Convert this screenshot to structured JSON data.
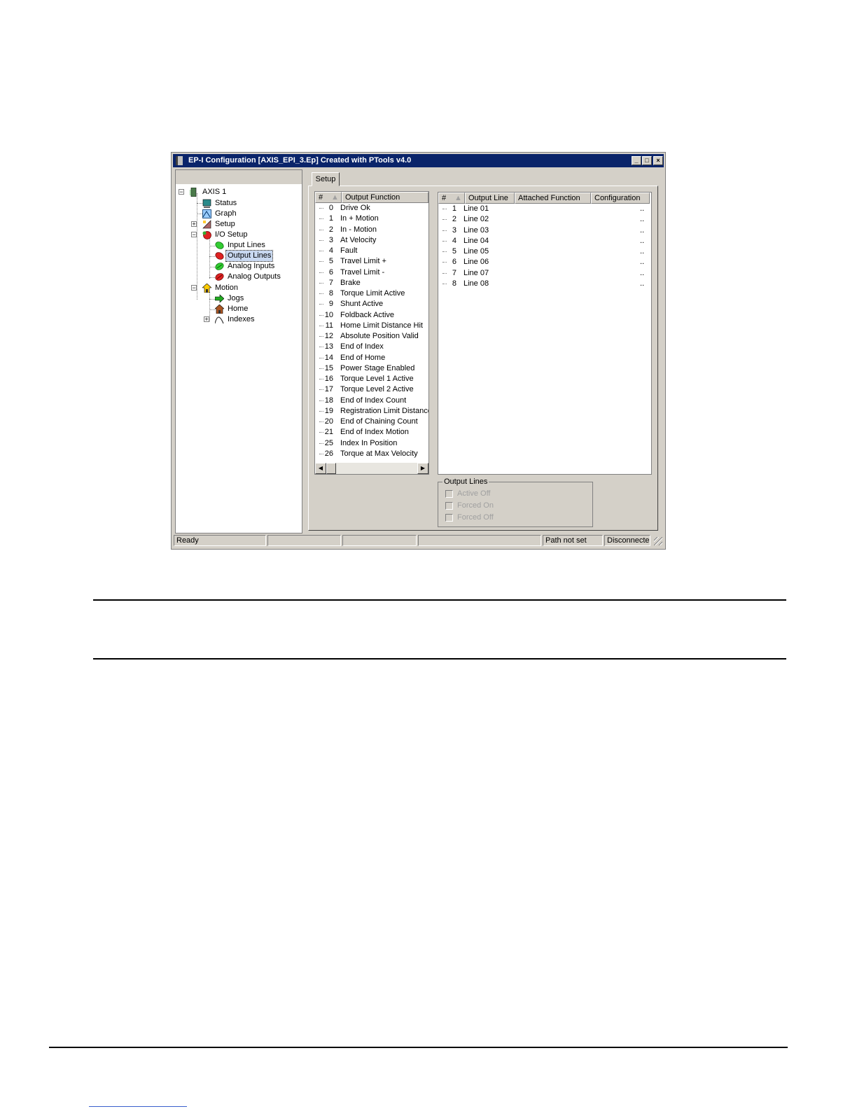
{
  "window": {
    "title": "EP-I Configuration  [AXIS_EPI_3.Ep] Created with PTools v4.0",
    "buttons": {
      "minimize": "_",
      "maximize": "□",
      "close": "×"
    }
  },
  "tree": {
    "root": "AXIS 1",
    "items": {
      "status": "Status",
      "graph": "Graph",
      "setup": "Setup",
      "io_setup": "I/O Setup",
      "input_lines": "Input Lines",
      "output_lines": "Output Lines",
      "analog_inputs": "Analog Inputs",
      "analog_outputs": "Analog Outputs",
      "motion": "Motion",
      "jogs": "Jogs",
      "home": "Home",
      "indexes": "Indexes"
    },
    "selected": "Output Lines"
  },
  "tab": {
    "label": "Setup"
  },
  "output_functions": {
    "headers": {
      "num": "#",
      "name": "Output Function"
    },
    "rows": [
      {
        "num": "0",
        "name": "Drive Ok"
      },
      {
        "num": "1",
        "name": "In + Motion"
      },
      {
        "num": "2",
        "name": "In - Motion"
      },
      {
        "num": "3",
        "name": "At Velocity"
      },
      {
        "num": "4",
        "name": "Fault"
      },
      {
        "num": "5",
        "name": "Travel Limit +"
      },
      {
        "num": "6",
        "name": "Travel Limit -"
      },
      {
        "num": "7",
        "name": "Brake"
      },
      {
        "num": "8",
        "name": "Torque Limit Active"
      },
      {
        "num": "9",
        "name": "Shunt Active"
      },
      {
        "num": "10",
        "name": "Foldback Active"
      },
      {
        "num": "11",
        "name": "Home Limit Distance Hit"
      },
      {
        "num": "12",
        "name": "Absolute Position Valid"
      },
      {
        "num": "13",
        "name": "End of Index"
      },
      {
        "num": "14",
        "name": "End of Home"
      },
      {
        "num": "15",
        "name": "Power Stage Enabled"
      },
      {
        "num": "16",
        "name": "Torque Level 1 Active"
      },
      {
        "num": "17",
        "name": "Torque Level 2 Active"
      },
      {
        "num": "18",
        "name": "End of Index Count"
      },
      {
        "num": "19",
        "name": "Registration Limit Distance Hit"
      },
      {
        "num": "20",
        "name": "End of Chaining Count"
      },
      {
        "num": "21",
        "name": "End of Index Motion"
      },
      {
        "num": "25",
        "name": "Index In Position"
      },
      {
        "num": "26",
        "name": "Torque at Max Velocity"
      }
    ],
    "scroll": {
      "left": "◀",
      "right": "▶"
    }
  },
  "output_lines": {
    "headers": {
      "num": "#",
      "line": "Output Line",
      "function": "Attached Function",
      "config": "Configuration"
    },
    "rows": [
      {
        "num": "1",
        "line": "Line 01",
        "config": ".."
      },
      {
        "num": "2",
        "line": "Line 02",
        "config": ".."
      },
      {
        "num": "3",
        "line": "Line 03",
        "config": ".."
      },
      {
        "num": "4",
        "line": "Line 04",
        "config": ".."
      },
      {
        "num": "5",
        "line": "Line 05",
        "config": ".."
      },
      {
        "num": "6",
        "line": "Line 06",
        "config": ".."
      },
      {
        "num": "7",
        "line": "Line 07",
        "config": ".."
      },
      {
        "num": "8",
        "line": "Line 08",
        "config": ".."
      }
    ]
  },
  "output_group": {
    "title": "Output Lines",
    "options": {
      "active_off": "Active Off",
      "forced_on": "Forced On",
      "forced_off": "Forced Off"
    }
  },
  "statusbar": {
    "ready": "Ready",
    "path": "Path not set",
    "connection": "Disconnected"
  },
  "colors": {
    "titlebar": "#0a246a",
    "face": "#d4d0c8",
    "selection": "#c8d8f0"
  }
}
